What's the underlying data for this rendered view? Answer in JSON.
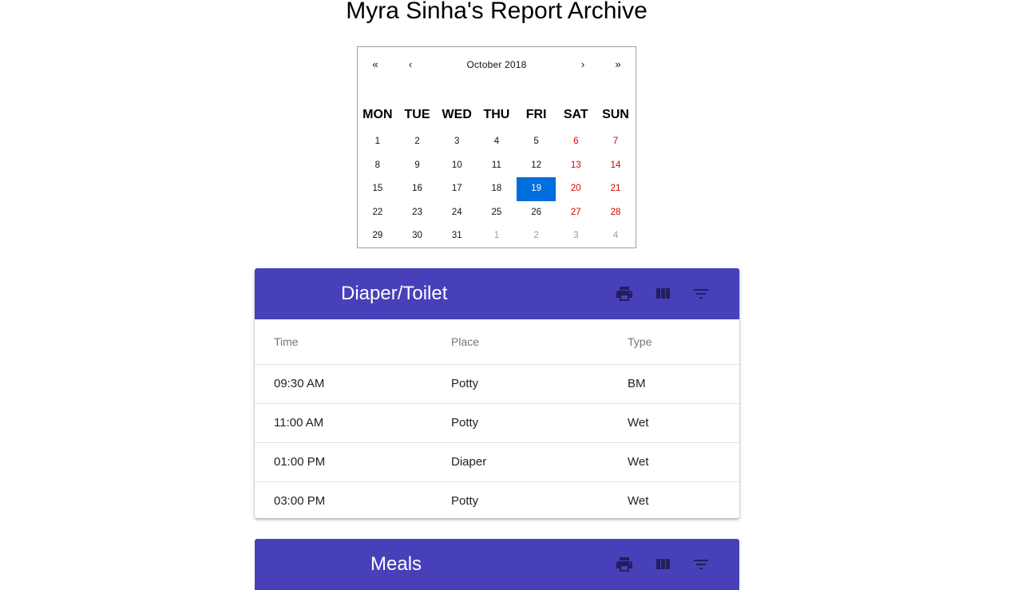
{
  "page": {
    "title": "Myra Sinha's Report Archive"
  },
  "calendar": {
    "nav": {
      "prev_year": "«",
      "prev_month": "‹",
      "month_label": "October 2018",
      "next_month": "›",
      "next_year": "»"
    },
    "weekdays": [
      "MON",
      "TUE",
      "WED",
      "THU",
      "FRI",
      "SAT",
      "SUN"
    ],
    "weeks": [
      [
        "1",
        "2",
        "3",
        "4",
        "5",
        "6",
        "7"
      ],
      [
        "8",
        "9",
        "10",
        "11",
        "12",
        "13",
        "14"
      ],
      [
        "15",
        "16",
        "17",
        "18",
        "19",
        "20",
        "21"
      ],
      [
        "22",
        "23",
        "24",
        "25",
        "26",
        "27",
        "28"
      ],
      [
        "29",
        "30",
        "31",
        "1",
        "2",
        "3",
        "4"
      ]
    ],
    "selected_day": "19",
    "colors": {
      "selected": "#006edc",
      "weekend": "#d10000",
      "other_month": "#9a9a9a"
    }
  },
  "diaper_card": {
    "title": "Diaper/Toilet",
    "icons": [
      "print-icon",
      "view-column-icon",
      "filter-list-icon"
    ],
    "columns": [
      "Time",
      "Place",
      "Type"
    ],
    "rows": [
      [
        "09:30 AM",
        "Potty",
        "BM"
      ],
      [
        "11:00 AM",
        "Potty",
        "Wet"
      ],
      [
        "01:00 PM",
        "Diaper",
        "Wet"
      ],
      [
        "03:00 PM",
        "Potty",
        "Wet"
      ]
    ],
    "header_color": "#4740b9"
  },
  "meals_card": {
    "title": "Meals",
    "icons": [
      "print-icon",
      "view-column-icon",
      "filter-list-icon"
    ]
  }
}
